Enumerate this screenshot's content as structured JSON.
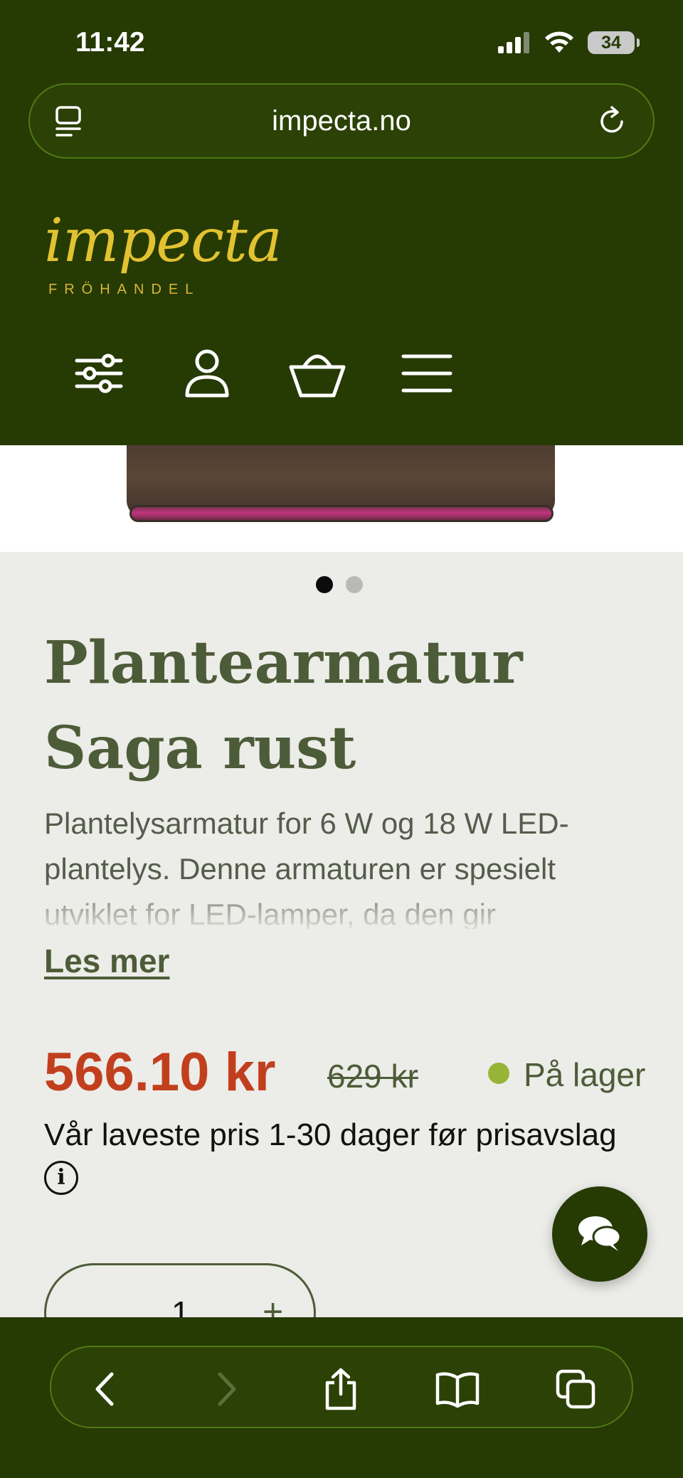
{
  "status_bar": {
    "time": "11:42",
    "battery": "34"
  },
  "browser": {
    "url": "impecta.no"
  },
  "brand": {
    "name": "impecta",
    "tagline": "FRÖHANDEL"
  },
  "header_icons": [
    "filter-icon",
    "account-icon",
    "basket-icon",
    "menu-icon"
  ],
  "gallery": {
    "slide_count": 2,
    "active_slide": 1
  },
  "product": {
    "title": "Plantearmatur Saga rust",
    "description": "Plantelysarmatur for 6 W og 18 W LED-plantelys. Denne armaturen er spesielt utviklet for LED-lamper, da den gir",
    "read_more": "Les mer",
    "price": "566.10 kr",
    "old_price": "629 kr",
    "stock": "På lager",
    "lowest_price_note": "Vår laveste pris 1-30 dager før prisavslag",
    "quantity": "1",
    "qty_plus": "+"
  },
  "colors": {
    "brand_green": "#263a04",
    "price_red": "#c23f1e",
    "stock_green": "#97b437",
    "logo_gold": "#e2c231"
  }
}
